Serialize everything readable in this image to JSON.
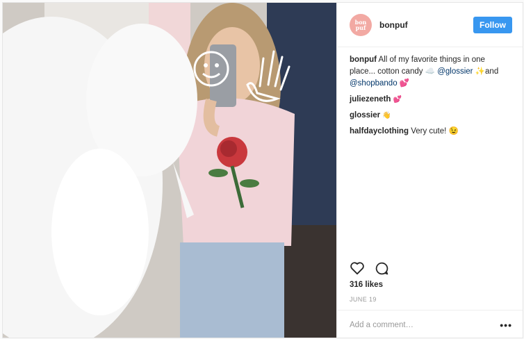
{
  "post": {
    "username": "bonpuf",
    "avatar_text": "bon puf",
    "follow_label": "Follow",
    "caption": {
      "user": "bonpuf",
      "text": "All of my favorite things in one place... cotton candy ☁️",
      "mention1": "@glossier",
      "mid": "✨and",
      "mention2": "@shopbando",
      "end": "💕"
    },
    "comments": [
      {
        "user": "juliezeneth",
        "text": "💕"
      },
      {
        "user": "glossier",
        "text": "👋"
      },
      {
        "user": "halfdayclothing",
        "text": "Very cute! 😉"
      }
    ],
    "likes": "316 likes",
    "date": "JUNE 19",
    "comment_placeholder": "Add a comment…",
    "more_label": "•••"
  },
  "icons": [
    "heart-icon",
    "comment-icon",
    "more-options-icon"
  ],
  "colors": {
    "follow": "#3897f0",
    "mention": "#003569",
    "avatar": "#f2a9a3"
  }
}
